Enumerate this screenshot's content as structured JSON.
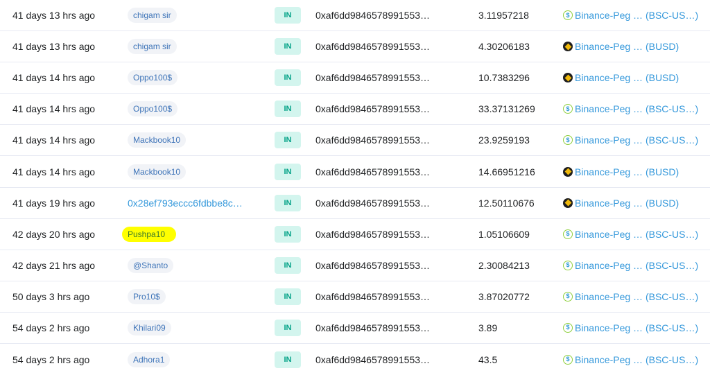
{
  "colors": {
    "in_badge_bg": "#d3f5ee",
    "in_badge_text": "#00a186",
    "link": "#3498db",
    "highlight": "#ffff00"
  },
  "rows": [
    {
      "age": "41 days 13 hrs ago",
      "from": "chigam sir",
      "from_type": "pill",
      "direction": "IN",
      "to": "0xaf6dd9846578991553…",
      "value": "3.11957218",
      "token_icon": "bsc-usd-icon",
      "token": "Binance-Peg … (BSC-US…)"
    },
    {
      "age": "41 days 13 hrs ago",
      "from": "chigam sir",
      "from_type": "pill",
      "direction": "IN",
      "to": "0xaf6dd9846578991553…",
      "value": "4.30206183",
      "token_icon": "busd-icon",
      "token": "Binance-Peg … (BUSD)"
    },
    {
      "age": "41 days 14 hrs ago",
      "from": "Oppo100$",
      "from_type": "pill",
      "direction": "IN",
      "to": "0xaf6dd9846578991553…",
      "value": "10.7383296",
      "token_icon": "busd-icon",
      "token": "Binance-Peg … (BUSD)"
    },
    {
      "age": "41 days 14 hrs ago",
      "from": "Oppo100$",
      "from_type": "pill",
      "direction": "IN",
      "to": "0xaf6dd9846578991553…",
      "value": "33.37131269",
      "token_icon": "bsc-usd-icon",
      "token": "Binance-Peg … (BSC-US…)"
    },
    {
      "age": "41 days 14 hrs ago",
      "from": "Mackbook10",
      "from_type": "pill",
      "direction": "IN",
      "to": "0xaf6dd9846578991553…",
      "value": "23.9259193",
      "token_icon": "bsc-usd-icon",
      "token": "Binance-Peg … (BSC-US…)"
    },
    {
      "age": "41 days 14 hrs ago",
      "from": "Mackbook10",
      "from_type": "pill",
      "direction": "IN",
      "to": "0xaf6dd9846578991553…",
      "value": "14.66951216",
      "token_icon": "busd-icon",
      "token": "Binance-Peg … (BUSD)"
    },
    {
      "age": "41 days 19 hrs ago",
      "from": "0x28ef793eccc6fdbbe8c…",
      "from_type": "link",
      "direction": "IN",
      "to": "0xaf6dd9846578991553…",
      "value": "12.50110676",
      "token_icon": "busd-icon",
      "token": "Binance-Peg … (BUSD)"
    },
    {
      "age": "42 days 20 hrs ago",
      "from": "Pushpa10",
      "from_type": "pill-highlight",
      "direction": "IN",
      "to": "0xaf6dd9846578991553…",
      "value": "1.05106609",
      "token_icon": "bsc-usd-icon",
      "token": "Binance-Peg … (BSC-US…)"
    },
    {
      "age": "42 days 21 hrs ago",
      "from": "@Shanto",
      "from_type": "pill",
      "direction": "IN",
      "to": "0xaf6dd9846578991553…",
      "value": "2.30084213",
      "token_icon": "bsc-usd-icon",
      "token": "Binance-Peg … (BSC-US…)"
    },
    {
      "age": "50 days 3 hrs ago",
      "from": "Pro10$",
      "from_type": "pill",
      "direction": "IN",
      "to": "0xaf6dd9846578991553…",
      "value": "3.87020772",
      "token_icon": "bsc-usd-icon",
      "token": "Binance-Peg … (BSC-US…)"
    },
    {
      "age": "54 days 2 hrs ago",
      "from": "Khilari09",
      "from_type": "pill",
      "direction": "IN",
      "to": "0xaf6dd9846578991553…",
      "value": "3.89",
      "token_icon": "bsc-usd-icon",
      "token": "Binance-Peg … (BSC-US…)"
    },
    {
      "age": "54 days 2 hrs ago",
      "from": "Adhora1",
      "from_type": "pill",
      "direction": "IN",
      "to": "0xaf6dd9846578991553…",
      "value": "43.5",
      "token_icon": "bsc-usd-icon",
      "token": "Binance-Peg … (BSC-US…)"
    }
  ]
}
